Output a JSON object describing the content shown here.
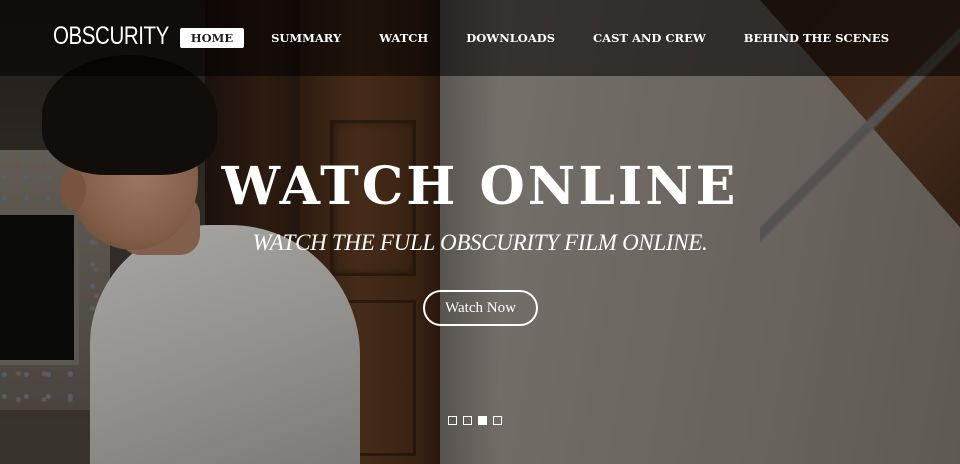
{
  "brand": "OBSCURITY",
  "nav": {
    "items": [
      {
        "label": "HOME",
        "active": true
      },
      {
        "label": "SUMMARY",
        "active": false
      },
      {
        "label": "WATCH",
        "active": false
      },
      {
        "label": "DOWNLOADS",
        "active": false
      },
      {
        "label": "CAST AND CREW",
        "active": false
      },
      {
        "label": "BEHIND THE SCENES",
        "active": false
      }
    ]
  },
  "hero": {
    "heading": "WATCH ONLINE",
    "subheading": "WATCH THE FULL OBSCURITY FILM ONLINE.",
    "cta_label": "Watch Now",
    "slides_total": 4,
    "active_slide": 3
  },
  "colors": {
    "text": "#ffffff",
    "active_nav_bg": "#ffffff",
    "active_nav_text": "#222222",
    "navbar_bg": "rgba(0,0,0,0.55)"
  }
}
